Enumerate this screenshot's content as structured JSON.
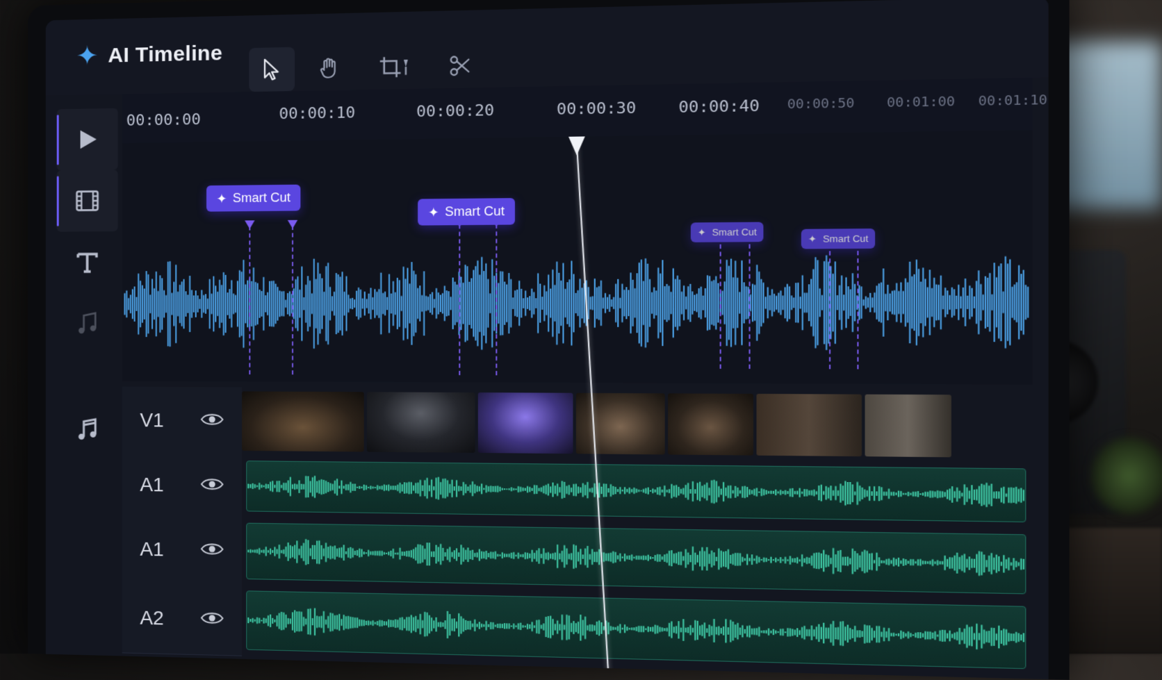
{
  "app": {
    "title": "AI Timeline",
    "logo_icon": "sparkle-icon",
    "accent": "#6b5cf5",
    "brand_color": "#4ba3f0"
  },
  "toolbar": {
    "tools": [
      {
        "name": "select",
        "icon": "cursor-icon",
        "active": true
      },
      {
        "name": "hand",
        "icon": "hand-icon",
        "active": false
      },
      {
        "name": "crop",
        "icon": "crop-icon",
        "active": false
      },
      {
        "name": "cut",
        "icon": "scissors-icon",
        "active": false
      }
    ]
  },
  "rail": {
    "items": [
      {
        "icon": "play-icon",
        "active": true
      },
      {
        "icon": "film-icon",
        "active": true
      },
      {
        "icon": "text-icon",
        "active": false
      },
      {
        "icon": "music-note-icon",
        "active": false
      },
      {
        "icon": "music-icon",
        "active": false
      }
    ]
  },
  "ruler": {
    "timecodes": [
      "00:00:00",
      "00:00:10",
      "00:00:20",
      "00:00:30",
      "00:00:40",
      "00:00:50",
      "00:01:00",
      "00:01:10"
    ]
  },
  "markers": {
    "label": "Smart Cut",
    "icon": "sparkle-icon",
    "color": "#5a46e0",
    "times_s": [
      4,
      21,
      44,
      55
    ]
  },
  "playhead": {
    "time": "00:00:30"
  },
  "tracks": [
    {
      "name": "V1",
      "type": "video",
      "visibility_icon": "eye-icon"
    },
    {
      "name": "A1",
      "type": "audio",
      "visibility_icon": "eye-icon"
    },
    {
      "name": "A1",
      "type": "audio",
      "visibility_icon": "eye-icon"
    },
    {
      "name": "A2",
      "type": "audio",
      "visibility_icon": "eye-icon"
    }
  ],
  "colors": {
    "waveform": "#4fa8f0",
    "audio_wave": "#3fc7a4",
    "marker": "#7b5cf0"
  }
}
